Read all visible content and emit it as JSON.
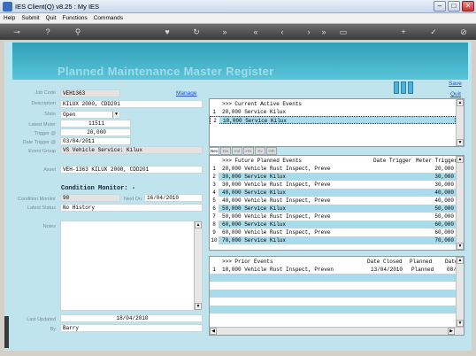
{
  "window": {
    "title": "IES Client(Q) v8.25 : My IES",
    "buttons": [
      "–",
      "□",
      "✕"
    ]
  },
  "menu": [
    "Help",
    "Submit",
    "Quit",
    "Functions",
    "Commands"
  ],
  "page": {
    "title": "Planned Maintenance Master Register",
    "save": "Save",
    "quit": "Quit",
    "manage": "Manage"
  },
  "form": {
    "job_code_label": "Job Code",
    "job_code": "VEH1363",
    "description_label": "Description",
    "description": "KILUX 2000, CDD201",
    "state_label": "State",
    "state": "Open",
    "latest_meter_label": "Latest Meter",
    "latest_meter": "11511",
    "trigger_label": "Trigger @",
    "trigger": "20,000",
    "date_trigger_label": "Date Trigger @",
    "date_trigger": "03/04/2011",
    "event_group_label": "Event Group",
    "event_group": "VS Vehicle Service: Kilux",
    "asset_label": "Asset",
    "asset": "VEH-1363 KILUX 2000, CDD201",
    "condition_monitor_title": "Condition Monitor: -",
    "condition_monitor_label": "Condition Monitor",
    "condition_monitor": "90",
    "next_on_label": "Next On",
    "next_on": "16/04/2010",
    "latest_status_label": "Latest Status",
    "latest_status": "No History",
    "notes_label": "Notes",
    "last_updated_label": "Last Updated",
    "last_updated": "18/04/2010",
    "by_label": "By",
    "by": "Barry"
  },
  "current_events": {
    "header": ">>> Current Active Events",
    "rows": [
      {
        "n": "1",
        "text": "20,000 Service Kilux"
      },
      {
        "n": "2",
        "text": "10,000 Service Kilux"
      }
    ]
  },
  "tabs": [
    "Nex",
    "Dw",
    "Ind",
    "Hrs",
    "Ev",
    "Oth"
  ],
  "future_events": {
    "header": ">>> Future Planned Events",
    "col_date": "Date Trigger",
    "col_meter": "Meter Trigger",
    "rows": [
      {
        "n": "1",
        "text": "20,000 Vehicle Rust Inspect, Preve",
        "meter": "20,000"
      },
      {
        "n": "2",
        "text": "30,000 Service Kilux",
        "meter": "30,000"
      },
      {
        "n": "3",
        "text": "30,000 Vehicle Rust Inspect, Preve",
        "meter": "30,000"
      },
      {
        "n": "4",
        "text": "40,000 Service Kilux",
        "meter": "40,000"
      },
      {
        "n": "5",
        "text": "40,000 Vehicle Rust Inspect, Preve",
        "meter": "40,000"
      },
      {
        "n": "6",
        "text": "50,000 Service Kilux",
        "meter": "50,000"
      },
      {
        "n": "7",
        "text": "50,000 Vehicle Rust Inspect, Preve",
        "meter": "50,000"
      },
      {
        "n": "8",
        "text": "60,000 Service Kilux",
        "meter": "60,000"
      },
      {
        "n": "9",
        "text": "60,000 Vehicle Rust Inspect, Preve",
        "meter": "60,000"
      },
      {
        "n": "10",
        "text": "70,000 Service Kilux",
        "meter": "70,000"
      }
    ]
  },
  "prior_events": {
    "header": ">>> Prior Events",
    "col_closed": "Date Closed",
    "col_planned": "Planned",
    "col_date": "Date",
    "rows": [
      {
        "n": "1",
        "text": "10,000 Vehicle Rust Inspect, Preven",
        "closed": "13/04/2010",
        "planned": "Planned",
        "date": "08/"
      }
    ]
  },
  "colors": {
    "header_band": "#2f9fb7",
    "content_bg": "#bfe4ee",
    "row_highlight": "#a8dced",
    "link": "#1f55c8"
  }
}
